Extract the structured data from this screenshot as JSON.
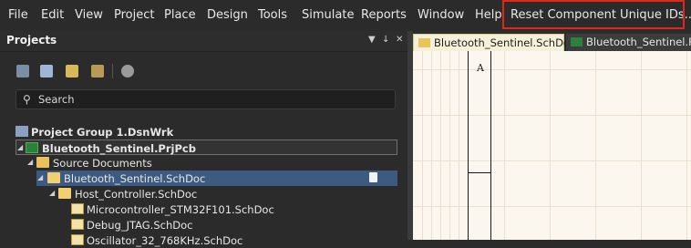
{
  "menubar": {
    "items": [
      "File",
      "Edit",
      "View",
      "Project",
      "Place",
      "Design",
      "Tools",
      "Simulate",
      "Reports",
      "Window",
      "Help"
    ],
    "highlighted_item": "Reset Component Unique IDs...",
    "highlight_color": "#e0271b"
  },
  "panel": {
    "title": "Projects",
    "controls": [
      "▼",
      "↓",
      "✕"
    ],
    "toolbar_icons": [
      "save-icon",
      "copy-icon",
      "open-folder-icon",
      "folder-settings-icon",
      "gear-icon"
    ],
    "search_placeholder": "Search"
  },
  "tree": [
    {
      "label": "Project Group 1.DsnWrk",
      "icon": "workspace-icon",
      "expanded": null
    },
    {
      "label": "Bluetooth_Sentinel.PrjPcb",
      "icon": "pcb-project-icon",
      "expanded": true
    },
    {
      "label": "Source Documents",
      "icon": "folder-icon",
      "expanded": true
    },
    {
      "label": "Bluetooth_Sentinel.SchDoc",
      "icon": "schematic-folder-icon",
      "expanded": true,
      "selected": true
    },
    {
      "label": "Host_Controller.SchDoc",
      "icon": "schematic-folder-icon",
      "expanded": true
    },
    {
      "label": "Microcontroller_STM32F101.SchDoc",
      "icon": "schematic-icon",
      "expanded": null
    },
    {
      "label": "Debug_JTAG.SchDoc",
      "icon": "schematic-icon",
      "expanded": null
    },
    {
      "label": "Oscillator_32_768KHz.SchDoc",
      "icon": "schematic-icon",
      "expanded": null
    }
  ],
  "tabs": [
    {
      "label": "Bluetooth_Sentinel.SchDoc",
      "active": true
    },
    {
      "label": "Bluetooth_Sentinel.Pc",
      "active": false
    }
  ],
  "sheet": {
    "zone_letter": "A",
    "background": "#fbf7ee"
  },
  "colors": {
    "selection": "#3d5b81",
    "panel_bg": "#2b2b2b"
  }
}
